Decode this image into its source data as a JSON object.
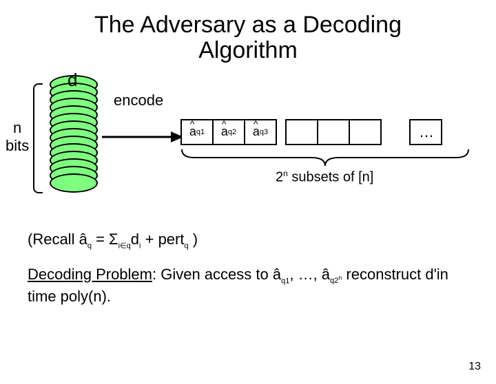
{
  "title_line1": "The Adversary as a Decoding",
  "title_line2": "Algorithm",
  "d_label": "d",
  "n_label": "n",
  "bits_label": "bits",
  "encode_label": "encode",
  "cell1_a": "a",
  "cell1_sub": "q1",
  "cell2_a": "a",
  "cell2_sub": "q2",
  "cell3_a": "a",
  "cell3_sub": "q3",
  "dots": "…",
  "subsets_prefix": "2",
  "subsets_sup": "n",
  "subsets_suffix": " subsets of [n]",
  "recall_open": "(Recall ",
  "recall_ahat": "â",
  "recall_q": "q",
  "recall_eq": " = ",
  "recall_sigma": "Σ",
  "recall_ieq": "i∈q",
  "recall_di": "d",
  "recall_i": "i",
  "recall_plus": " + pert",
  "recall_pertq": "q",
  "recall_close": " )",
  "decoding_label": "Decoding Problem",
  "decoding_text1": ": Given access to ",
  "decoding_a": "â",
  "decoding_q1": "q1",
  "decoding_comma": ", …, ",
  "decoding_q2n_pre": "q2",
  "decoding_q2n_sup": "n",
  "decoding_text2": " reconstruct ",
  "decoding_d": "d'",
  "decoding_text3": "in time poly(n).",
  "page_num": "13"
}
